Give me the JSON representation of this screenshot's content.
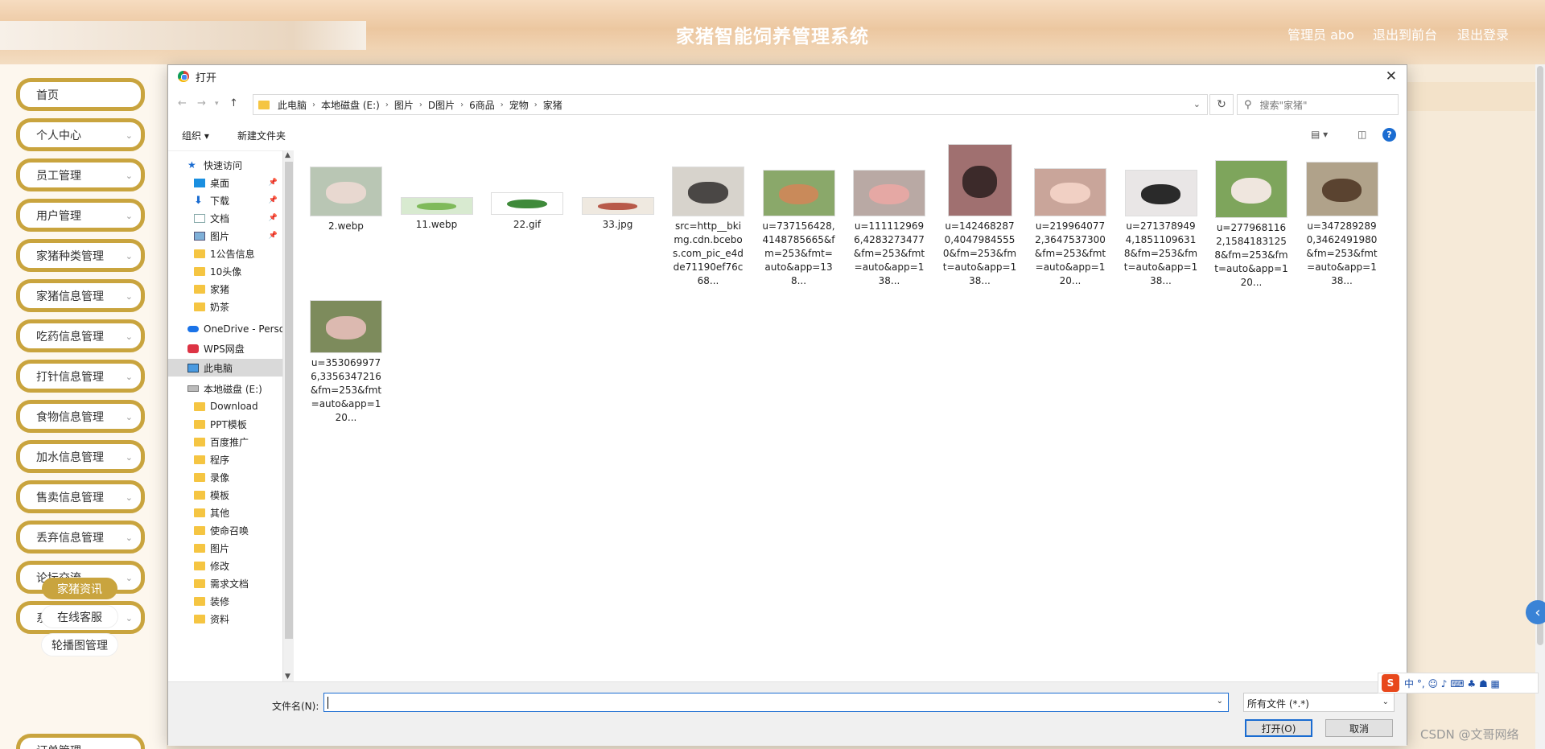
{
  "header": {
    "title": "家猪智能饲养管理系统",
    "user": "管理员 abo",
    "to_front": "退出到前台",
    "logout": "退出登录"
  },
  "sidebar": {
    "items": [
      {
        "label": "首页",
        "chevron": false
      },
      {
        "label": "个人中心",
        "chevron": true
      },
      {
        "label": "员工管理",
        "chevron": true
      },
      {
        "label": "用户管理",
        "chevron": true
      },
      {
        "label": "家猪种类管理",
        "chevron": true
      },
      {
        "label": "家猪信息管理",
        "chevron": true
      },
      {
        "label": "吃药信息管理",
        "chevron": true
      },
      {
        "label": "打针信息管理",
        "chevron": true
      },
      {
        "label": "食物信息管理",
        "chevron": true
      },
      {
        "label": "加水信息管理",
        "chevron": true
      },
      {
        "label": "售卖信息管理",
        "chevron": true
      },
      {
        "label": "丢弃信息管理",
        "chevron": true
      },
      {
        "label": "论坛交流",
        "chevron": true
      },
      {
        "label": "系统管理",
        "chevron": true
      }
    ],
    "sub_items": [
      "家猪资讯",
      "在线客服",
      "轮播图管理"
    ],
    "last_item": "订单管理"
  },
  "dialog": {
    "title": "打开",
    "close": "✕",
    "breadcrumb": [
      "此电脑",
      "本地磁盘 (E:)",
      "图片",
      "D图片",
      "6商品",
      "宠物",
      "家猪"
    ],
    "search_placeholder": "搜索\"家猪\"",
    "toolbar": {
      "organize": "组织 ▾",
      "new_folder": "新建文件夹",
      "help": "?"
    },
    "nav_pane": [
      {
        "label": "快速访问",
        "icon": "star-icon",
        "type": "star",
        "pinned": false,
        "indent": 0
      },
      {
        "label": "桌面",
        "icon": "desktop-icon",
        "type": "desk",
        "pinned": true,
        "indent": 1
      },
      {
        "label": "下载",
        "icon": "download-icon",
        "type": "dl",
        "pinned": true,
        "indent": 1
      },
      {
        "label": "文档",
        "icon": "document-icon",
        "type": "doc",
        "pinned": true,
        "indent": 1
      },
      {
        "label": "图片",
        "icon": "pictures-icon",
        "type": "pic",
        "pinned": true,
        "indent": 1
      },
      {
        "label": "1公告信息",
        "icon": "folder-icon",
        "type": "folder",
        "pinned": false,
        "indent": 1
      },
      {
        "label": "10头像",
        "icon": "folder-icon",
        "type": "folder",
        "pinned": false,
        "indent": 1
      },
      {
        "label": "家猪",
        "icon": "folder-icon",
        "type": "folder",
        "pinned": false,
        "indent": 1
      },
      {
        "label": "奶茶",
        "icon": "folder-icon",
        "type": "folder",
        "pinned": false,
        "indent": 1
      },
      {
        "label": "OneDrive - Perso",
        "icon": "onedrive-icon",
        "type": "cloud",
        "pinned": false,
        "indent": 0
      },
      {
        "label": "WPS网盘",
        "icon": "wps-icon",
        "type": "wps",
        "pinned": false,
        "indent": 0
      },
      {
        "label": "此电脑",
        "icon": "computer-icon",
        "type": "pc",
        "pinned": false,
        "indent": 0,
        "selected": true
      },
      {
        "label": "本地磁盘 (E:)",
        "icon": "drive-icon",
        "type": "drive",
        "pinned": false,
        "indent": 0
      },
      {
        "label": "Download",
        "icon": "folder-icon",
        "type": "folder",
        "pinned": false,
        "indent": 1
      },
      {
        "label": "PPT模板",
        "icon": "folder-icon",
        "type": "folder",
        "pinned": false,
        "indent": 1
      },
      {
        "label": "百度推广",
        "icon": "folder-icon",
        "type": "folder",
        "pinned": false,
        "indent": 1
      },
      {
        "label": "程序",
        "icon": "folder-icon",
        "type": "folder",
        "pinned": false,
        "indent": 1
      },
      {
        "label": "录像",
        "icon": "folder-icon",
        "type": "folder",
        "pinned": false,
        "indent": 1
      },
      {
        "label": "模板",
        "icon": "folder-icon",
        "type": "folder",
        "pinned": false,
        "indent": 1
      },
      {
        "label": "其他",
        "icon": "folder-icon",
        "type": "folder",
        "pinned": false,
        "indent": 1
      },
      {
        "label": "使命召唤",
        "icon": "folder-icon",
        "type": "folder",
        "pinned": false,
        "indent": 1
      },
      {
        "label": "图片",
        "icon": "folder-icon",
        "type": "folder",
        "pinned": false,
        "indent": 1
      },
      {
        "label": "修改",
        "icon": "folder-icon",
        "type": "folder",
        "pinned": false,
        "indent": 1
      },
      {
        "label": "需求文档",
        "icon": "folder-icon",
        "type": "folder",
        "pinned": false,
        "indent": 1
      },
      {
        "label": "装修",
        "icon": "folder-icon",
        "type": "folder",
        "pinned": false,
        "indent": 1
      },
      {
        "label": "资料",
        "icon": "folder-icon",
        "type": "folder",
        "pinned": false,
        "indent": 1
      }
    ],
    "files": [
      {
        "name": "2.webp",
        "bg": "#b9c6b4",
        "fg": "#e8d8d0"
      },
      {
        "name": "11.webp",
        "bg": "#d8ead0",
        "fg": "#7fba5a"
      },
      {
        "name": "22.gif",
        "bg": "#ffffff",
        "fg": "#3f8a3a"
      },
      {
        "name": "33.jpg",
        "bg": "#efe9e0",
        "fg": "#b85a4a"
      },
      {
        "name": "src=http__bkimg.cdn.bcebos.com_pic_e4dde71190ef76c68...",
        "bg": "#d7d3cc",
        "fg": "#4a4745"
      },
      {
        "name": "u=737156428,4148785665&fm=253&fmt=auto&app=138...",
        "bg": "#8aa86a",
        "fg": "#c98a5a"
      },
      {
        "name": "u=1111129696,4283273477&fm=253&fmt=auto&app=138...",
        "bg": "#b9a9a4",
        "fg": "#e5a8a4"
      },
      {
        "name": "u=1424682870,40479845550&fm=253&fmt=auto&app=138...",
        "bg": "#a07070",
        "fg": "#3c2a2a"
      },
      {
        "name": "u=2199640772,3647537300&fm=253&fmt=auto&app=120...",
        "bg": "#c9a59a",
        "fg": "#f1d0c4"
      },
      {
        "name": "u=2713789494,18511096318&fm=253&fmt=auto&app=138...",
        "bg": "#e9e6e6",
        "fg": "#2a2a2a"
      },
      {
        "name": "u=2779681162,15841831258&fm=253&fmt=auto&app=120...",
        "bg": "#7ea55c",
        "fg": "#efe6de"
      },
      {
        "name": "u=3472892890,3462491980&fm=253&fmt=auto&app=138...",
        "bg": "#b0a28a",
        "fg": "#5a4330"
      },
      {
        "name": "u=3530699776,3356347216&fm=253&fmt=auto&app=120...",
        "bg": "#7d8b5c",
        "fg": "#dcb9b0"
      }
    ],
    "filename_label": "文件名(N):",
    "filename_value": "",
    "filetype": "所有文件 (*.*)",
    "open_button": "打开(O)",
    "cancel_button": "取消"
  },
  "ime": {
    "logo": "S",
    "text": "中 °, ☺ ♪ ⌨ ♣ ☗ ▦"
  },
  "watermark": "CSDN @文哥网络",
  "float_button": "‹"
}
